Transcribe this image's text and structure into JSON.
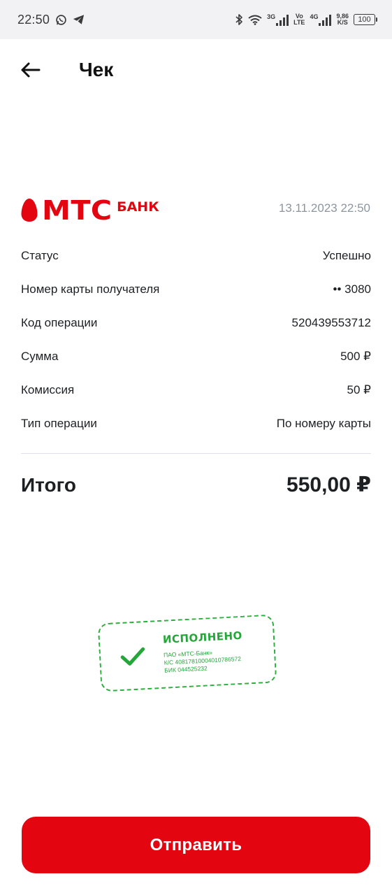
{
  "status_bar": {
    "time": "22:50",
    "network_3g": "3G",
    "volte_top": "Vo",
    "volte_bottom": "LTE",
    "network_4g": "4G",
    "speed_value": "9,86",
    "speed_unit": "K/S",
    "battery": "100",
    "icons": [
      "whatsapp-icon",
      "telegram-icon",
      "bluetooth-icon",
      "wifi-icon",
      "signal-icon",
      "battery-icon"
    ]
  },
  "header": {
    "title": "Чек",
    "back_icon": "arrow-left-icon"
  },
  "receipt": {
    "brand_primary": "МТС",
    "brand_secondary": "БАНК",
    "date": "13.11.2023 22:50",
    "rows": [
      {
        "label": "Статус",
        "value": "Успешно"
      },
      {
        "label": "Номер карты получателя",
        "value": "•• 3080"
      },
      {
        "label": "Код операции",
        "value": "520439553712"
      },
      {
        "label": "Сумма",
        "value": "500 ₽"
      },
      {
        "label": "Комиссия",
        "value": "50 ₽"
      },
      {
        "label": "Тип операции",
        "value": "По номеру карты"
      }
    ],
    "total_label": "Итого",
    "total_value": "550,00 ₽"
  },
  "stamp": {
    "title": "ИСПОЛНЕНО",
    "line1": "ПАО «МТС-Банк»",
    "line2": "К/С 40817810004010786572",
    "line3": "БИК 044525232"
  },
  "actions": {
    "send_label": "Отправить"
  },
  "colors": {
    "brand_red": "#e30611",
    "stamp_green": "#24a639",
    "muted_text": "#8d969f",
    "status_bar_bg": "#f2f2f4"
  }
}
